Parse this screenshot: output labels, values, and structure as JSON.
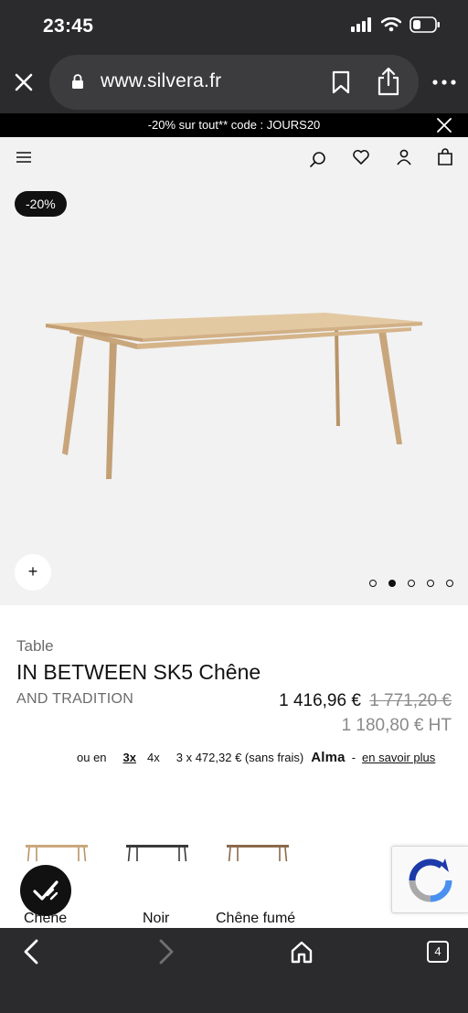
{
  "status_bar": {
    "time": "23:45"
  },
  "browser": {
    "url": "www.silvera.fr",
    "tab_count": "4"
  },
  "promo": {
    "text": "-20% sur tout** code : JOURS20"
  },
  "product": {
    "discount_badge": "-20%",
    "zoom_label": "+",
    "carousel": {
      "total": 5,
      "active_index": 1
    },
    "category": "Table",
    "title": "IN BETWEEN SK5 Chêne",
    "brand": "AND TRADITION",
    "price_current": "1 416,96 €",
    "price_old": "1 771,20 €",
    "price_ht": "1 180,80 € HT"
  },
  "alma": {
    "prefix": "ou en",
    "option_3x": "3x",
    "option_4x": "4x",
    "installment": "3 x 472,32 € (sans frais)",
    "brand": "Alma",
    "separator": "-",
    "learn_more": "en savoir plus"
  },
  "variants": [
    {
      "label": "Chêne",
      "color": "#c9a77c"
    },
    {
      "label": "Noir",
      "color": "#3a3a3a"
    },
    {
      "label": "Chêne fumé",
      "color": "#8a6a4b"
    }
  ],
  "colors": {
    "chrome": "#2b2b2d",
    "banner": "#000000",
    "image_bg": "#f2f2f2",
    "wood": "#d8b88e"
  }
}
